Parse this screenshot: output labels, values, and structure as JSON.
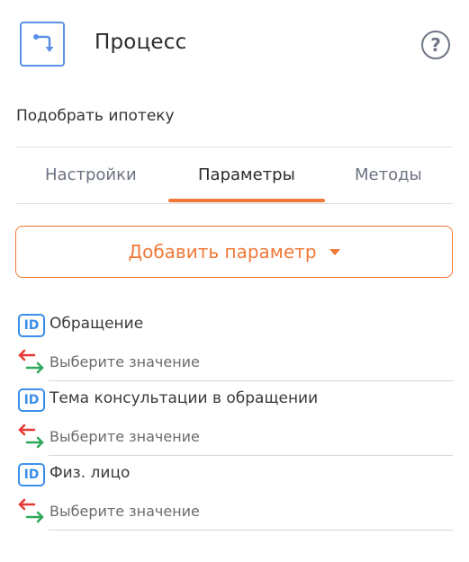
{
  "header": {
    "title": "Процесс",
    "icon": "process-route-icon",
    "help_icon_glyph": "?"
  },
  "subtitle": "Подобрать ипотеку",
  "tabs": [
    {
      "label": "Настройки",
      "active": false
    },
    {
      "label": "Параметры",
      "active": true
    },
    {
      "label": "Методы",
      "active": false
    }
  ],
  "add_button": {
    "label": "Добавить параметр"
  },
  "params": [
    {
      "badge": "ID",
      "name": "Обращение",
      "value_placeholder": "Выберите значение"
    },
    {
      "badge": "ID",
      "name": "Тема консультации в обращении",
      "value_placeholder": "Выберите значение"
    },
    {
      "badge": "ID",
      "name": "Физ. лицо",
      "value_placeholder": "Выберите значение"
    }
  ],
  "colors": {
    "accent": "#f07838",
    "id_badge": "#3b8ee8",
    "arrow_left": "#e53935",
    "arrow_right": "#2eaa5a",
    "process_icon": "#5d8fe6"
  }
}
